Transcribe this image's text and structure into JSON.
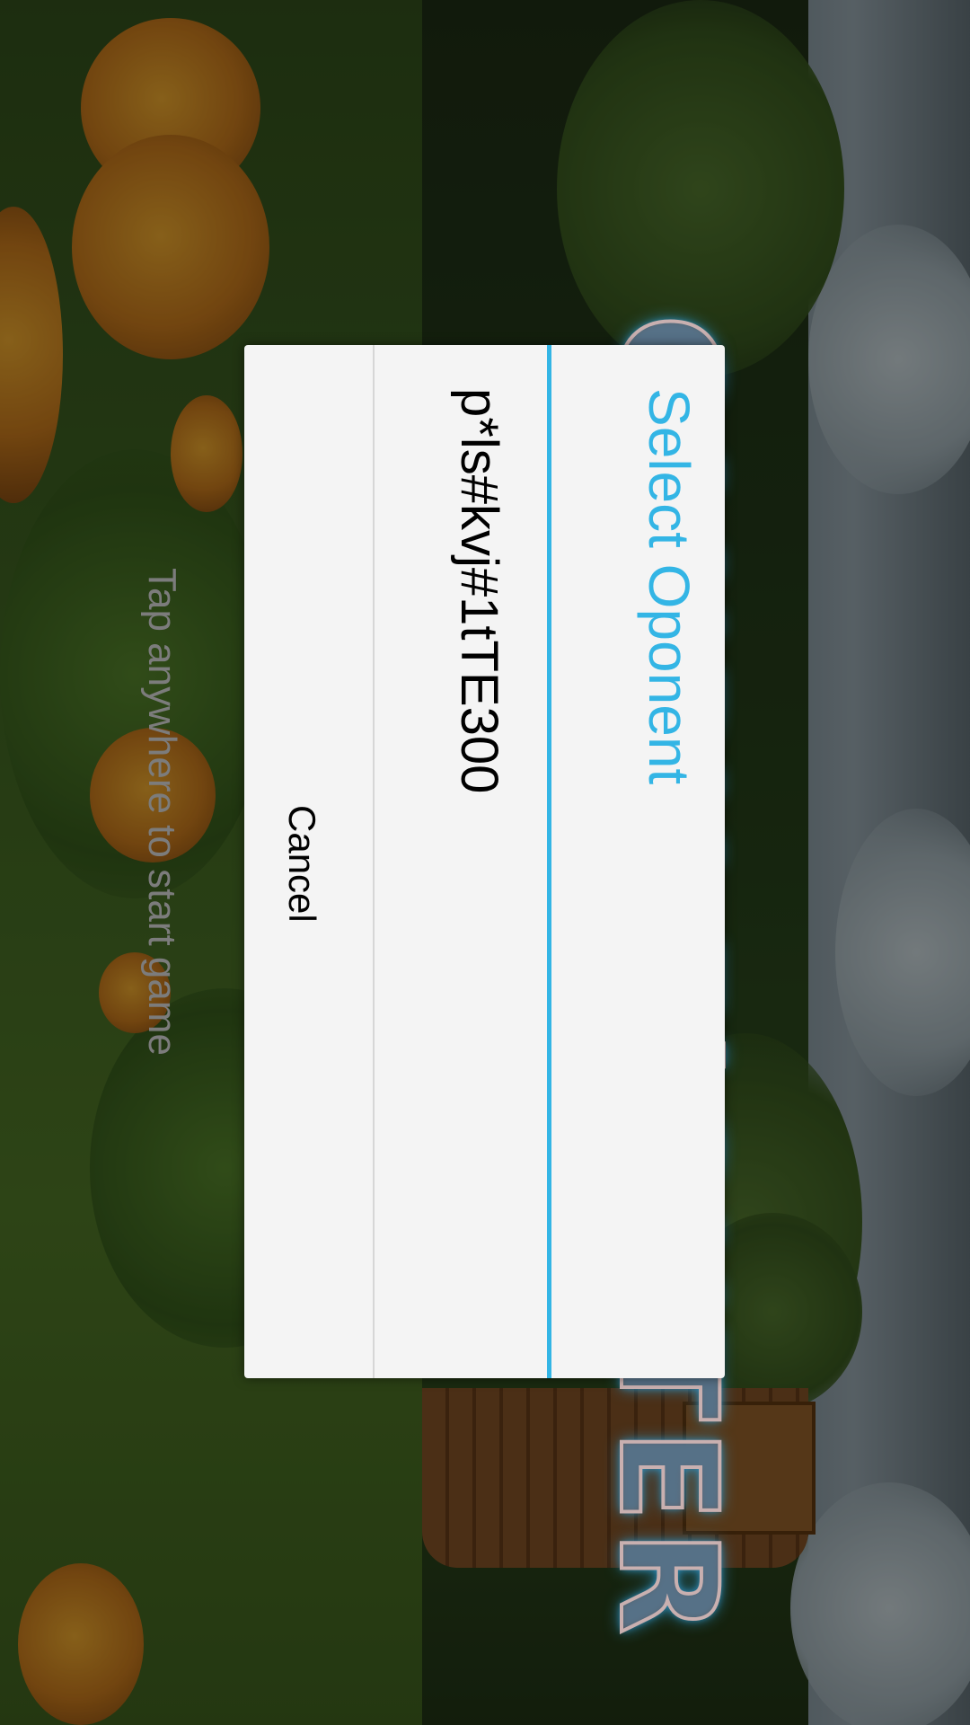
{
  "game": {
    "title": "CANDY FiGHTER",
    "tap_hint": "Tap anywhere to start game"
  },
  "dialog": {
    "title": "Select Oponent",
    "options": [
      "p*ls#kvj#1tTE300"
    ],
    "cancel_label": "Cancel"
  },
  "colors": {
    "accent": "#33b5e5",
    "dialog_background": "#f4f4f4",
    "option_text": "#000000",
    "hint_text": "#7c7c7c"
  }
}
